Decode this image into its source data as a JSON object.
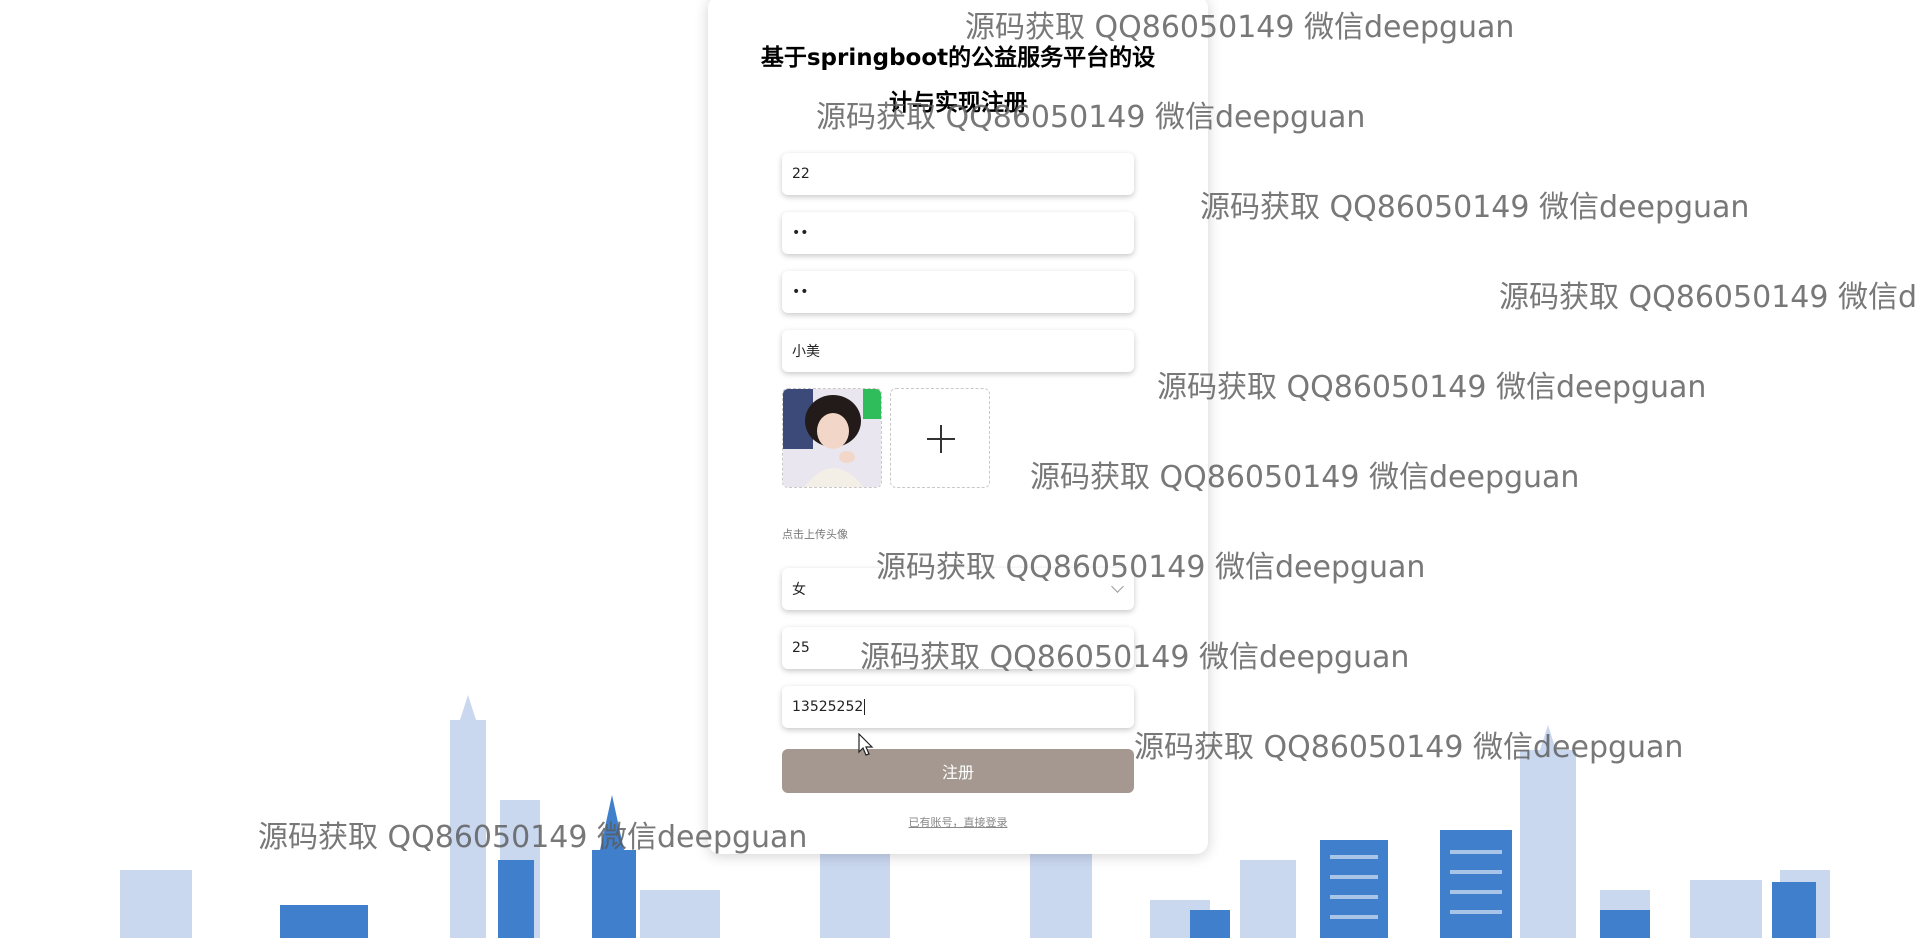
{
  "page": {
    "title_line1": "基于springboot的公益服务平台的设",
    "title_line2": "计与实现注册"
  },
  "form": {
    "account_value": "22",
    "password_value": "••",
    "confirm_password_value": "••",
    "name_value": "小美",
    "avatar_alt": "avatar photo",
    "upload_plus": "+",
    "upload_hint": "点击上传头像",
    "gender_value": "女",
    "age_value": "25",
    "phone_value": "13525252",
    "submit_label": "注册",
    "login_link": "已有账号，直接登录"
  },
  "watermark": {
    "text": "源码获取 QQ86050149 微信deepguan",
    "text_clipped": "源码获取 QQ86050149 微信de",
    "color": "#5a5a5a"
  },
  "colors": {
    "submit_bg": "#a49891",
    "skyline_blue": "#3d7cc9",
    "skyline_light": "#c8d6ef"
  }
}
